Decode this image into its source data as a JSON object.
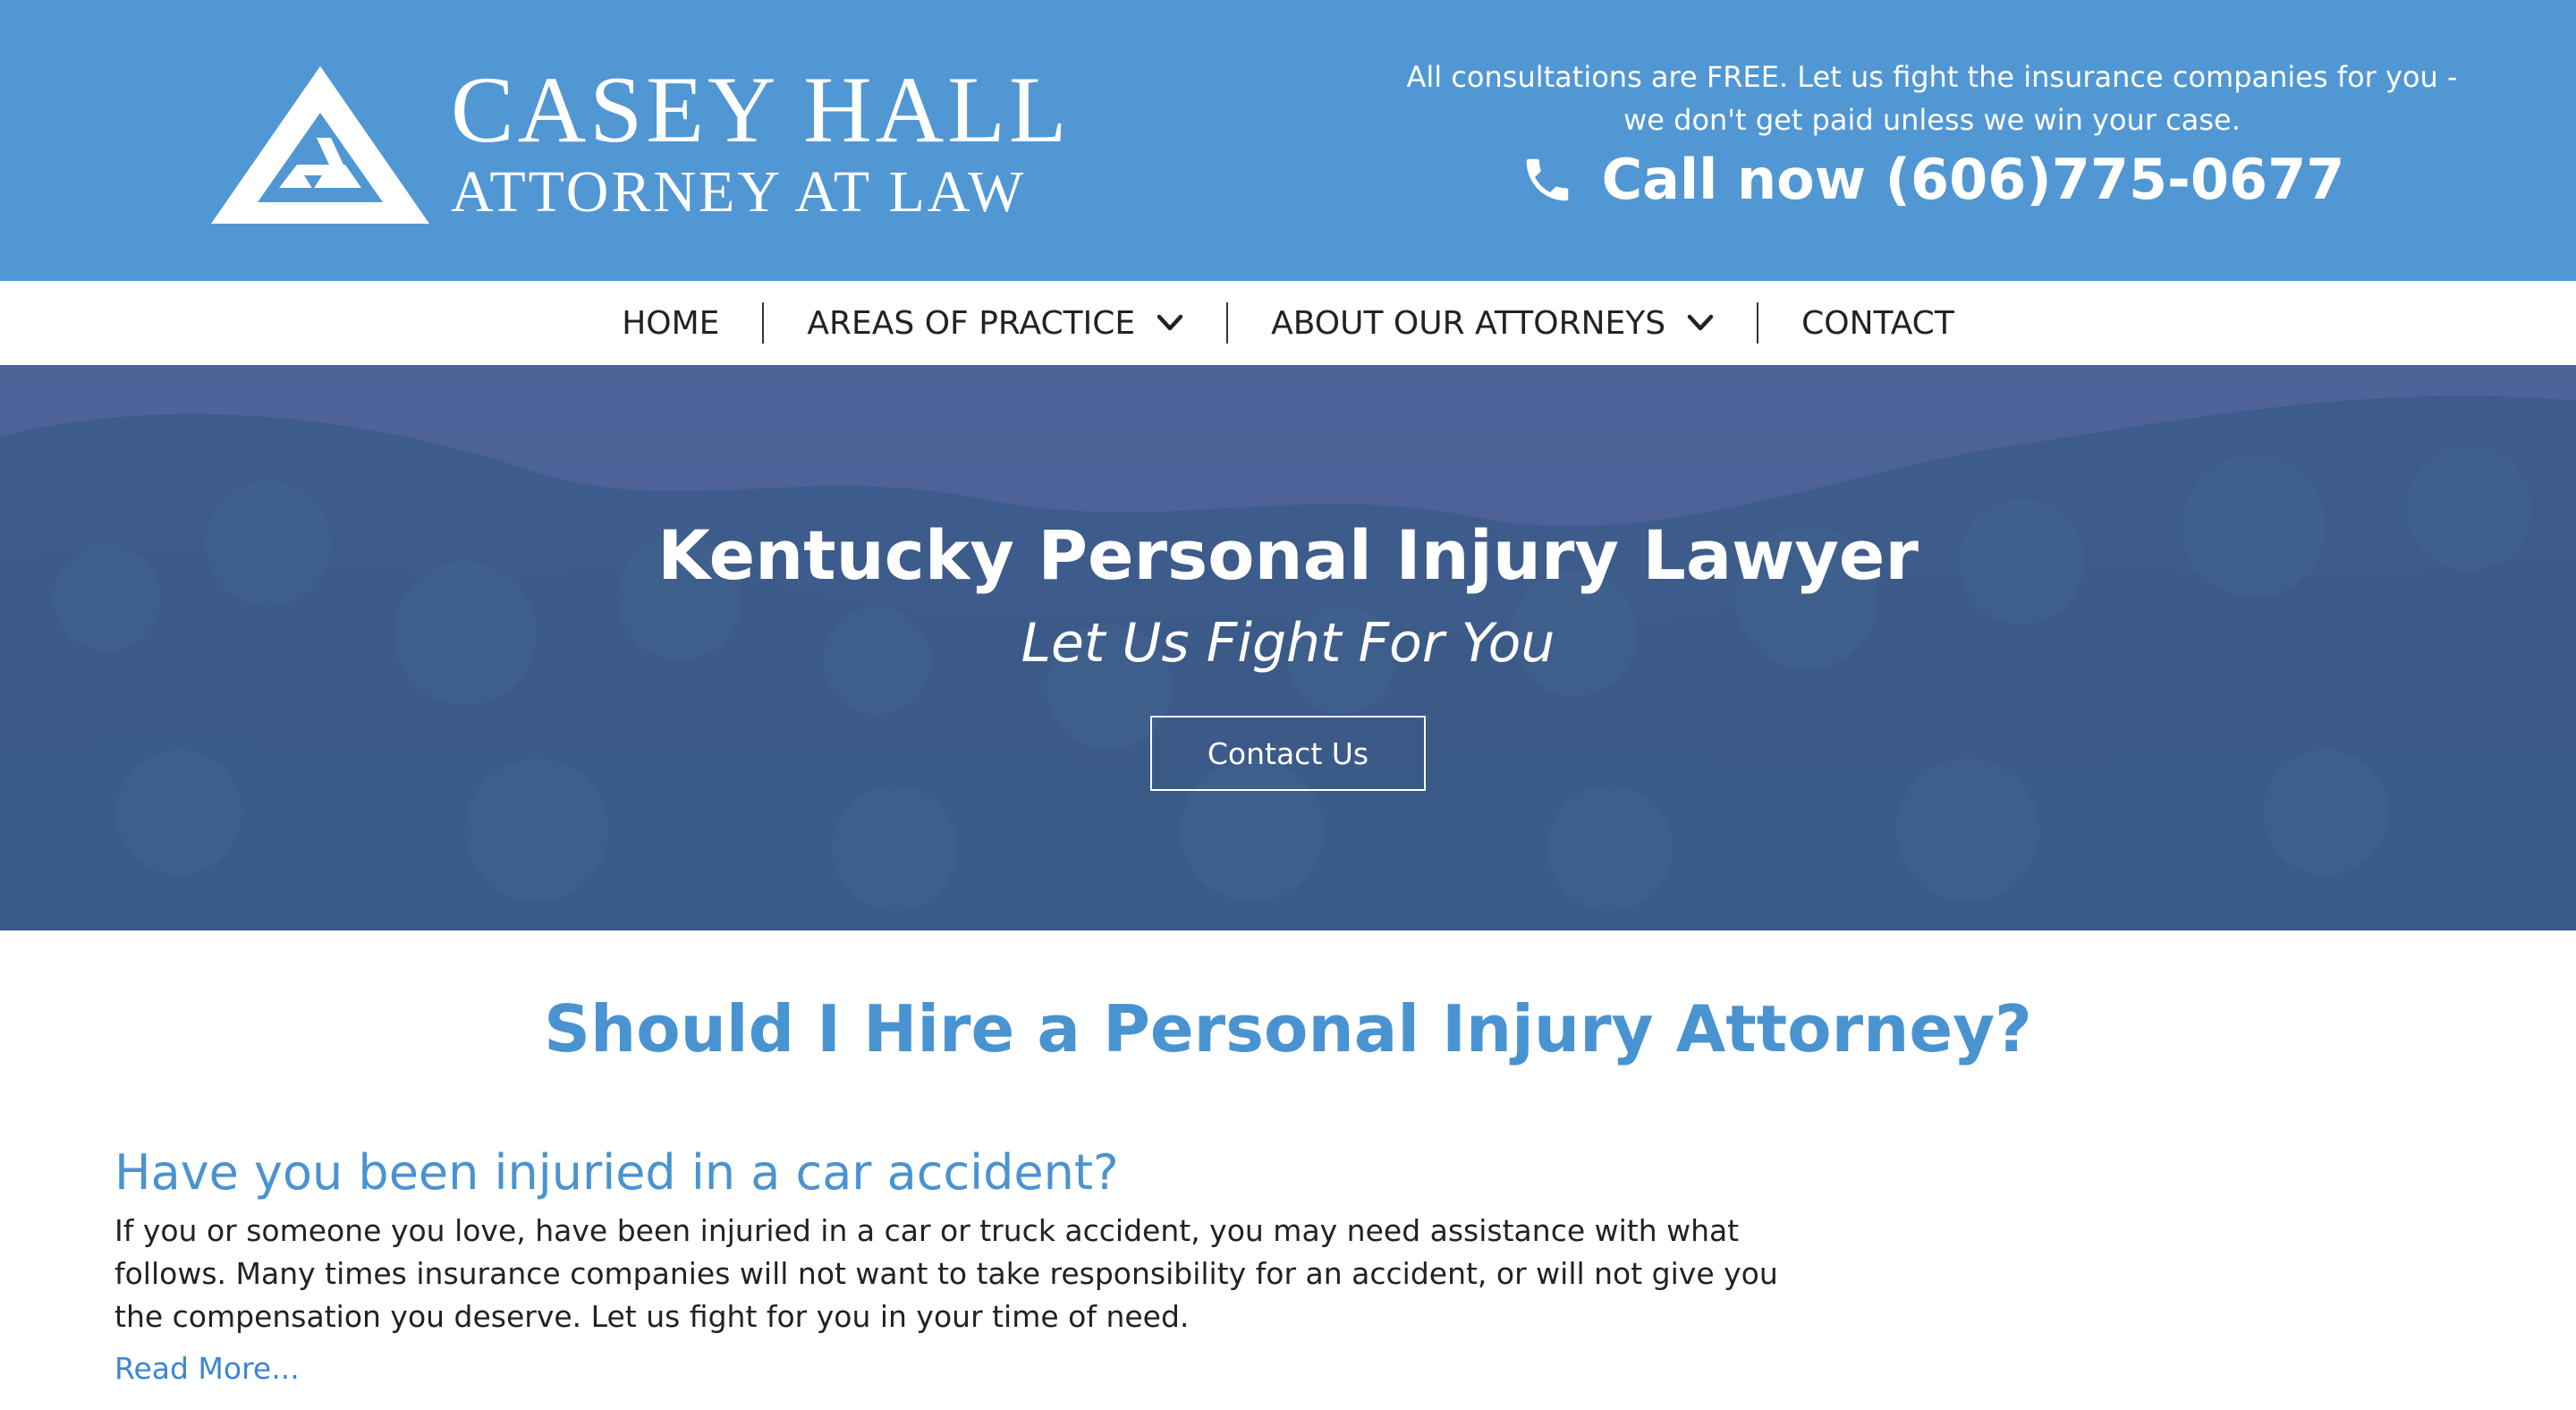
{
  "header": {
    "logo": {
      "name": "CASEY HALL",
      "tagline": "ATTORNEY AT LAW"
    },
    "consultation_text": "All consultations are FREE. Let us fight the insurance companies for you - we don't get paid unless we win your case.",
    "call_now": "Call now (606)775-0677",
    "colors": {
      "brand_blue": "#5197d4",
      "heading_blue": "#4a93d1"
    },
    "icons": [
      "logo-triangle-icon",
      "phone-icon"
    ]
  },
  "nav": {
    "items": [
      {
        "label": "HOME",
        "has_dropdown": false
      },
      {
        "label": "AREAS OF PRACTICE",
        "has_dropdown": true
      },
      {
        "label": "ABOUT OUR ATTORNEYS",
        "has_dropdown": true
      },
      {
        "label": "CONTACT",
        "has_dropdown": false
      }
    ]
  },
  "hero": {
    "title": "Kentucky Personal Injury Lawyer",
    "subtitle": "Let Us Fight For You",
    "button_label": "Contact Us"
  },
  "main": {
    "section_title": "Should I Hire a Personal Injury Attorney?",
    "article": {
      "title": "Have you been injuried in a car accident?",
      "body": "If you or someone you love, have been injuried in a car or truck accident, you may need assistance with what follows. Many times insurance companies will not want to take responsibility for an accident, or will not give you the compensation you deserve. Let us fight for you in your time of need.",
      "read_more": "Read More..."
    }
  }
}
